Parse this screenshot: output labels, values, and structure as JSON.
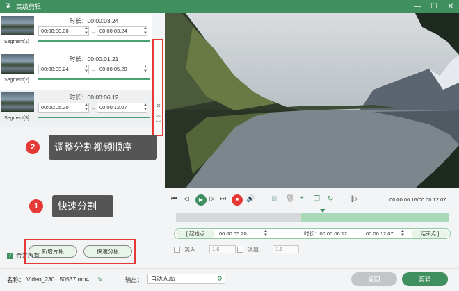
{
  "window": {
    "title": "高级剪辑"
  },
  "segments": [
    {
      "label": "Segment[1]",
      "duration": "时长：00:00:03.24",
      "start": "00:00:00.00",
      "end": "00:00:03.24"
    },
    {
      "label": "Segment[2]",
      "duration": "时长：00:00:01.21",
      "start": "00:00:03.24",
      "end": "00:00:05.20"
    },
    {
      "label": "Segment[3]",
      "duration": "时长：00:00:06.12",
      "start": "00:00:05.20",
      "end": "00:00:12.07"
    }
  ],
  "callouts": {
    "reorder": {
      "num": "2",
      "text": "调整分割视频顺序"
    },
    "split": {
      "num": "1",
      "text": "快速分割"
    }
  },
  "buttons": {
    "add_segment": "新增片段",
    "quick_split": "快速分段",
    "back": "返回",
    "edit": "剪辑"
  },
  "merge_all": "合并所有",
  "player": {
    "timecode": "00:00:06.16/00:00:12.07"
  },
  "trim": {
    "start_label": "起始点",
    "start": "00:00:05.20",
    "duration": "时长：00:00:06.12",
    "end": "00:00:12.07",
    "end_label": "结束点"
  },
  "fade": {
    "fade_in": "淡入",
    "fade_in_value": "1.6",
    "fade_out": "淡出",
    "fade_out_value": "1.6"
  },
  "bottom": {
    "name_label": "名称：",
    "name_value": "Video_230...50537.mp4",
    "output_label": "输出：",
    "output_value": "自动;Auto"
  },
  "colors": {
    "brand": "#3f8f5f",
    "highlight": "#e53935"
  },
  "icons": [
    "app-logo-icon",
    "minimize-icon",
    "maximize-icon",
    "close-icon",
    "chevron-up-icon",
    "chevron-down-icon",
    "play-icon",
    "stop-icon",
    "volume-icon",
    "gear-icon",
    "pencil-icon"
  ]
}
